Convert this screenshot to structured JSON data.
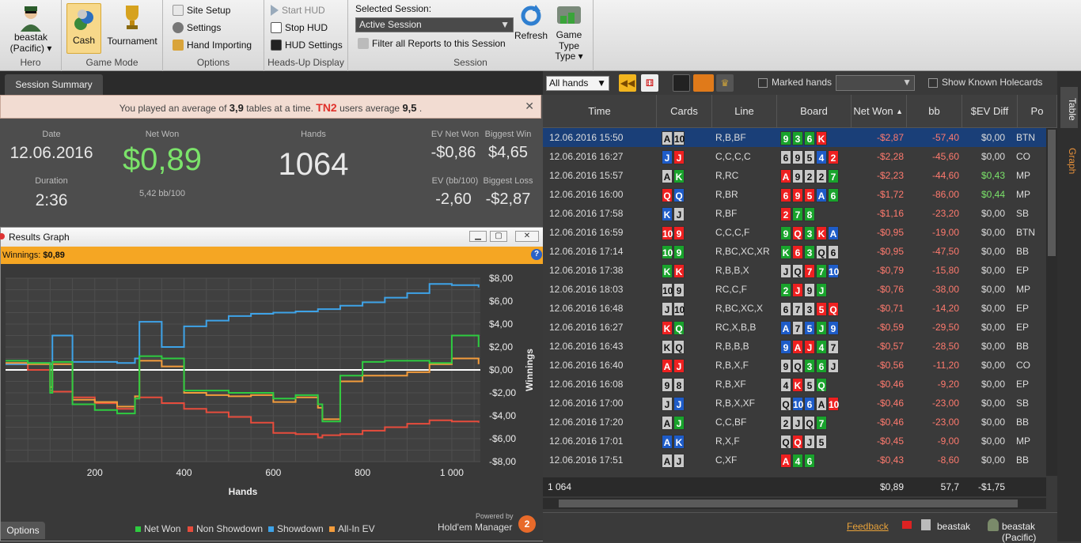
{
  "ribbon": {
    "hero": {
      "name": "beastak",
      "site": "(Pacific)",
      "group_label": "Hero"
    },
    "game_mode": {
      "cash": "Cash",
      "tournament": "Tournament",
      "group_label": "Game Mode"
    },
    "options": {
      "site_setup": "Site Setup",
      "settings": "Settings",
      "hand_importing": "Hand Importing",
      "group_label": "Options"
    },
    "hud": {
      "start": "Start HUD",
      "stop": "Stop HUD",
      "settings": "HUD Settings",
      "group_label": "Heads-Up Display"
    },
    "session": {
      "selected_label": "Selected Session:",
      "selected_value": "Active Session",
      "filter": "Filter all Reports to this Session",
      "refresh": "Refresh",
      "game_type": "Game Type",
      "group_label": "Session"
    }
  },
  "summary": {
    "tab": "Session Summary",
    "notice": {
      "pre": "You played an average of",
      "avg": "3,9",
      "mid": "tables at a time.",
      "site": "TN2",
      "post": "users average",
      "site_avg": "9,5",
      "end": "."
    },
    "date_label": "Date",
    "date": "12.06.2016",
    "duration_label": "Duration",
    "duration": "2:36",
    "net_won_label": "Net Won",
    "net_won": "$0,89",
    "bb100": "5,42 bb/100",
    "hands_label": "Hands",
    "hands": "1064",
    "ev_net_label": "EV Net Won",
    "ev_net": "-$0,86",
    "ev_bb_label": "EV (bb/100)",
    "ev_bb": "-2,60",
    "biggest_win_label": "Biggest Win",
    "biggest_win": "$4,65",
    "biggest_loss_label": "Biggest Loss",
    "biggest_loss": "-$2,87"
  },
  "graph": {
    "title": "Results Graph",
    "winnings_label": "Winnings:",
    "winnings": "$0,89",
    "options": "Options",
    "powered": "Powered by",
    "brand": "Hold'em Manager",
    "chart_data": {
      "type": "line",
      "xlabel": "Hands",
      "ylabel": "Winnings",
      "xlim": [
        0,
        1064
      ],
      "ylim": [
        -8,
        8
      ],
      "x_ticks": [
        "200",
        "400",
        "600",
        "800",
        "1 000"
      ],
      "y_ticks": [
        "$8,00",
        "$6,00",
        "$4,00",
        "$2,00",
        "$0,00",
        "-$2,00",
        "-$4,00",
        "-$6,00",
        "-$8,00"
      ],
      "x": [
        0,
        50,
        100,
        105,
        150,
        200,
        250,
        290,
        300,
        350,
        400,
        450,
        500,
        550,
        600,
        650,
        700,
        710,
        750,
        800,
        850,
        900,
        950,
        1000,
        1060
      ],
      "series": [
        {
          "name": "Net Won",
          "color": "#2ecc40",
          "values": [
            0.8,
            0.6,
            -2.0,
            0.7,
            -3.0,
            -3.5,
            -3.8,
            -2.5,
            1.2,
            1.0,
            -1.8,
            -1.8,
            -2.0,
            -2.0,
            -2.5,
            -2.2,
            -3.0,
            -4.5,
            -0.5,
            0.7,
            0.8,
            0.8,
            0.6,
            3.0,
            2.0
          ]
        },
        {
          "name": "Non Showdown",
          "color": "#e74c3c",
          "values": [
            0.5,
            0.0,
            -1.8,
            -1.9,
            -2.4,
            -2.9,
            -3.4,
            -2.5,
            -2.4,
            -2.9,
            -3.4,
            -3.7,
            -4.1,
            -4.6,
            -5.5,
            -5.6,
            -5.9,
            -5.7,
            -5.6,
            -5.3,
            -5.0,
            -4.7,
            -4.4,
            -4.5,
            -4.6
          ]
        },
        {
          "name": "Showdown",
          "color": "#3ea3e8",
          "values": [
            0.5,
            0.6,
            0.5,
            3.0,
            0.7,
            0.7,
            0.6,
            1.0,
            4.2,
            2.0,
            3.8,
            4.3,
            4.7,
            4.9,
            5.0,
            5.1,
            5.3,
            5.3,
            5.6,
            5.9,
            6.3,
            6.7,
            7.5,
            7.4,
            7.2
          ]
        },
        {
          "name": "All-In EV",
          "color": "#f39c3c",
          "values": [
            0.6,
            0.5,
            -1.5,
            0.5,
            -2.6,
            -2.8,
            -3.2,
            -2.3,
            0.8,
            0.3,
            -2.0,
            -2.2,
            -2.3,
            -2.2,
            -2.8,
            -2.4,
            -3.3,
            -4.3,
            -1.0,
            -0.5,
            -0.5,
            -0.2,
            0.5,
            1.0,
            0.5
          ]
        }
      ]
    }
  },
  "table": {
    "filter_value": "All hands",
    "marked_hands": "Marked hands",
    "show_known": "Show Known Holecards",
    "columns": [
      "Time",
      "Cards",
      "Line",
      "Board",
      "Net Won",
      "bb",
      "$EV Diff",
      "Po"
    ],
    "rows": [
      {
        "time": "12.06.2016 15:50",
        "cards": [
          [
            "A",
            "s"
          ],
          [
            "10",
            "s"
          ]
        ],
        "line": "R,B,BF",
        "board": [
          [
            "9",
            "c"
          ],
          [
            "3",
            "c"
          ],
          [
            "6",
            "c"
          ],
          [
            "K",
            "h"
          ]
        ],
        "net": "-$2,87",
        "bb": "-57,40",
        "ev": "$0,00",
        "pos": "BTN",
        "sel": true
      },
      {
        "time": "12.06.2016 16:27",
        "cards": [
          [
            "J",
            "d"
          ],
          [
            "J",
            "h"
          ]
        ],
        "line": "C,C,C,C",
        "board": [
          [
            "6",
            "s"
          ],
          [
            "9",
            "s"
          ],
          [
            "5",
            "s"
          ],
          [
            "4",
            "d"
          ],
          [
            "2",
            "h"
          ]
        ],
        "net": "-$2,28",
        "bb": "-45,60",
        "ev": "$0,00",
        "pos": "CO"
      },
      {
        "time": "12.06.2016 15:57",
        "cards": [
          [
            "A",
            "s"
          ],
          [
            "K",
            "c"
          ]
        ],
        "line": "R,RC",
        "board": [
          [
            "A",
            "h"
          ],
          [
            "9",
            "s"
          ],
          [
            "2",
            "s"
          ],
          [
            "2",
            "s"
          ],
          [
            "7",
            "c"
          ]
        ],
        "net": "-$2,23",
        "bb": "-44,60",
        "ev": "$0,43",
        "pos": "MP"
      },
      {
        "time": "12.06.2016 16:00",
        "cards": [
          [
            "Q",
            "h"
          ],
          [
            "Q",
            "d"
          ]
        ],
        "line": "R,BR",
        "board": [
          [
            "6",
            "h"
          ],
          [
            "9",
            "h"
          ],
          [
            "5",
            "h"
          ],
          [
            "A",
            "d"
          ],
          [
            "6",
            "c"
          ]
        ],
        "net": "-$1,72",
        "bb": "-86,00",
        "ev": "$0,44",
        "pos": "MP"
      },
      {
        "time": "12.06.2016 17:58",
        "cards": [
          [
            "K",
            "d"
          ],
          [
            "J",
            "s"
          ]
        ],
        "line": "R,BF",
        "board": [
          [
            "2",
            "h"
          ],
          [
            "7",
            "c"
          ],
          [
            "8",
            "c"
          ]
        ],
        "net": "-$1,16",
        "bb": "-23,20",
        "ev": "$0,00",
        "pos": "SB"
      },
      {
        "time": "12.06.2016 16:59",
        "cards": [
          [
            "10",
            "h"
          ],
          [
            "9",
            "h"
          ]
        ],
        "line": "C,C,C,F",
        "board": [
          [
            "9",
            "c"
          ],
          [
            "Q",
            "h"
          ],
          [
            "3",
            "c"
          ],
          [
            "K",
            "h"
          ],
          [
            "A",
            "d"
          ]
        ],
        "net": "-$0,95",
        "bb": "-19,00",
        "ev": "$0,00",
        "pos": "BTN"
      },
      {
        "time": "12.06.2016 17:14",
        "cards": [
          [
            "10",
            "c"
          ],
          [
            "9",
            "c"
          ]
        ],
        "line": "R,BC,XC,XR",
        "board": [
          [
            "K",
            "c"
          ],
          [
            "6",
            "h"
          ],
          [
            "3",
            "c"
          ],
          [
            "Q",
            "s"
          ],
          [
            "6",
            "s"
          ]
        ],
        "net": "-$0,95",
        "bb": "-47,50",
        "ev": "$0,00",
        "pos": "BB"
      },
      {
        "time": "12.06.2016 17:38",
        "cards": [
          [
            "K",
            "c"
          ],
          [
            "K",
            "h"
          ]
        ],
        "line": "R,B,B,X",
        "board": [
          [
            "J",
            "s"
          ],
          [
            "Q",
            "s"
          ],
          [
            "7",
            "h"
          ],
          [
            "7",
            "c"
          ],
          [
            "10",
            "d"
          ]
        ],
        "net": "-$0,79",
        "bb": "-15,80",
        "ev": "$0,00",
        "pos": "EP"
      },
      {
        "time": "12.06.2016 18:03",
        "cards": [
          [
            "10",
            "s"
          ],
          [
            "9",
            "s"
          ]
        ],
        "line": "RC,C,F",
        "board": [
          [
            "2",
            "c"
          ],
          [
            "J",
            "h"
          ],
          [
            "9",
            "s"
          ],
          [
            "J",
            "c"
          ]
        ],
        "net": "-$0,76",
        "bb": "-38,00",
        "ev": "$0,00",
        "pos": "MP"
      },
      {
        "time": "12.06.2016 16:48",
        "cards": [
          [
            "J",
            "s"
          ],
          [
            "10",
            "s"
          ]
        ],
        "line": "R,BC,XC,X",
        "board": [
          [
            "6",
            "s"
          ],
          [
            "7",
            "s"
          ],
          [
            "3",
            "s"
          ],
          [
            "5",
            "h"
          ],
          [
            "Q",
            "h"
          ]
        ],
        "net": "-$0,71",
        "bb": "-14,20",
        "ev": "$0,00",
        "pos": "EP"
      },
      {
        "time": "12.06.2016 16:27",
        "cards": [
          [
            "K",
            "h"
          ],
          [
            "Q",
            "c"
          ]
        ],
        "line": "RC,X,B,B",
        "board": [
          [
            "A",
            "d"
          ],
          [
            "7",
            "s"
          ],
          [
            "5",
            "d"
          ],
          [
            "J",
            "c"
          ],
          [
            "9",
            "d"
          ]
        ],
        "net": "-$0,59",
        "bb": "-29,50",
        "ev": "$0,00",
        "pos": "EP"
      },
      {
        "time": "12.06.2016 16:43",
        "cards": [
          [
            "K",
            "s"
          ],
          [
            "Q",
            "s"
          ]
        ],
        "line": "R,B,B,B",
        "board": [
          [
            "9",
            "d"
          ],
          [
            "A",
            "h"
          ],
          [
            "J",
            "h"
          ],
          [
            "4",
            "c"
          ],
          [
            "7",
            "s"
          ]
        ],
        "net": "-$0,57",
        "bb": "-28,50",
        "ev": "$0,00",
        "pos": "BB"
      },
      {
        "time": "12.06.2016 16:40",
        "cards": [
          [
            "A",
            "h"
          ],
          [
            "J",
            "h"
          ]
        ],
        "line": "R,B,X,F",
        "board": [
          [
            "9",
            "s"
          ],
          [
            "Q",
            "s"
          ],
          [
            "3",
            "c"
          ],
          [
            "6",
            "c"
          ],
          [
            "J",
            "s"
          ]
        ],
        "net": "-$0,56",
        "bb": "-11,20",
        "ev": "$0,00",
        "pos": "CO"
      },
      {
        "time": "12.06.2016 16:08",
        "cards": [
          [
            "9",
            "s"
          ],
          [
            "8",
            "s"
          ]
        ],
        "line": "R,B,XF",
        "board": [
          [
            "4",
            "s"
          ],
          [
            "K",
            "h"
          ],
          [
            "5",
            "s"
          ],
          [
            "Q",
            "c"
          ]
        ],
        "net": "-$0,46",
        "bb": "-9,20",
        "ev": "$0,00",
        "pos": "EP"
      },
      {
        "time": "12.06.2016 17:00",
        "cards": [
          [
            "J",
            "s"
          ],
          [
            "J",
            "d"
          ]
        ],
        "line": "R,B,X,XF",
        "board": [
          [
            "Q",
            "s"
          ],
          [
            "10",
            "d"
          ],
          [
            "6",
            "d"
          ],
          [
            "A",
            "s"
          ],
          [
            "10",
            "h"
          ]
        ],
        "net": "-$0,46",
        "bb": "-23,00",
        "ev": "$0,00",
        "pos": "SB"
      },
      {
        "time": "12.06.2016 17:20",
        "cards": [
          [
            "A",
            "s"
          ],
          [
            "J",
            "c"
          ]
        ],
        "line": "C,C,BF",
        "board": [
          [
            "2",
            "s"
          ],
          [
            "J",
            "s"
          ],
          [
            "Q",
            "s"
          ],
          [
            "7",
            "c"
          ]
        ],
        "net": "-$0,46",
        "bb": "-23,00",
        "ev": "$0,00",
        "pos": "BB"
      },
      {
        "time": "12.06.2016 17:01",
        "cards": [
          [
            "A",
            "d"
          ],
          [
            "K",
            "d"
          ]
        ],
        "line": "R,X,F",
        "board": [
          [
            "Q",
            "s"
          ],
          [
            "Q",
            "h"
          ],
          [
            "J",
            "s"
          ],
          [
            "5",
            "s"
          ]
        ],
        "net": "-$0,45",
        "bb": "-9,00",
        "ev": "$0,00",
        "pos": "MP"
      },
      {
        "time": "12.06.2016 17:51",
        "cards": [
          [
            "A",
            "s"
          ],
          [
            "J",
            "s"
          ]
        ],
        "line": "C,XF",
        "board": [
          [
            "A",
            "h"
          ],
          [
            "4",
            "c"
          ],
          [
            "6",
            "c"
          ]
        ],
        "net": "-$0,43",
        "bb": "-8,60",
        "ev": "$0,00",
        "pos": "BB"
      }
    ],
    "totals": {
      "hands": "1 064",
      "net": "$0,89",
      "bb": "57,7",
      "ev": "-$1,75"
    }
  },
  "side": {
    "table_tab": "Table",
    "graph_tab": "Graph"
  },
  "status": {
    "feedback": "Feedback",
    "user": "beastak",
    "user_site": "beastak (Pacific)"
  },
  "colors": {
    "accent": "#f5a623",
    "net_won": "#2ecc40",
    "loss": "#ff7a6e"
  }
}
